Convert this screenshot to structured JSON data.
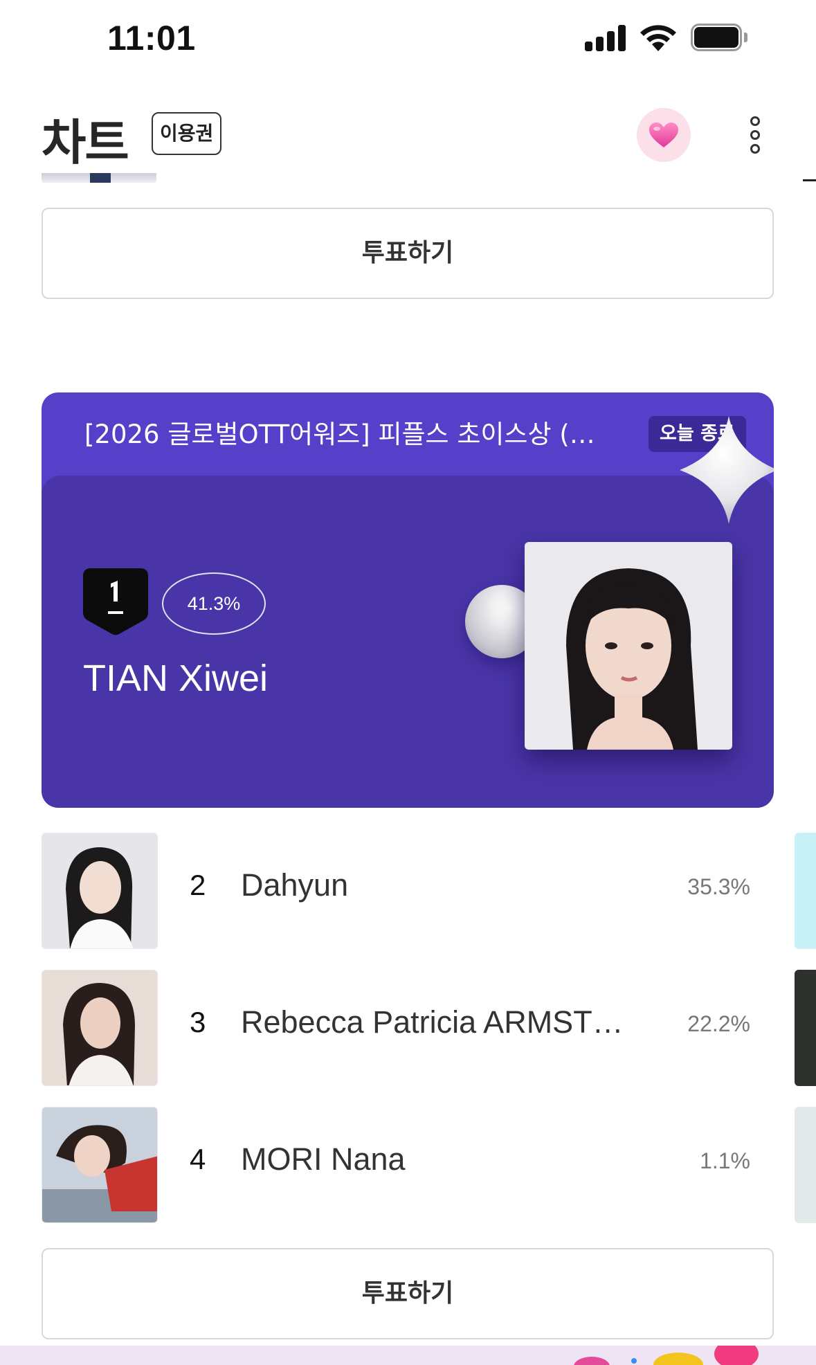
{
  "status_bar": {
    "time": "11:01"
  },
  "header": {
    "title": "차트",
    "pass_badge": "이용권"
  },
  "vote_button_label": "투표하기",
  "event": {
    "title": "[2026 글로벌OTT어워즈] 피플스 초이스상 (…",
    "ends_badge": "오늘 종료",
    "winner": {
      "rank": 1,
      "percent": "41.3%",
      "name": "TIAN Xiwei"
    }
  },
  "rankings": [
    {
      "rank": "2",
      "name": "Dahyun",
      "percent": "35.3%"
    },
    {
      "rank": "3",
      "name": "Rebecca Patricia ARMST…",
      "percent": "22.2%"
    },
    {
      "rank": "4",
      "name": "MORI Nana",
      "percent": "1.1%"
    }
  ],
  "colors": {
    "card_purple": "#5640c9",
    "card_inner_purple": "#4a35a8",
    "heart_pink": "#e94b97"
  }
}
